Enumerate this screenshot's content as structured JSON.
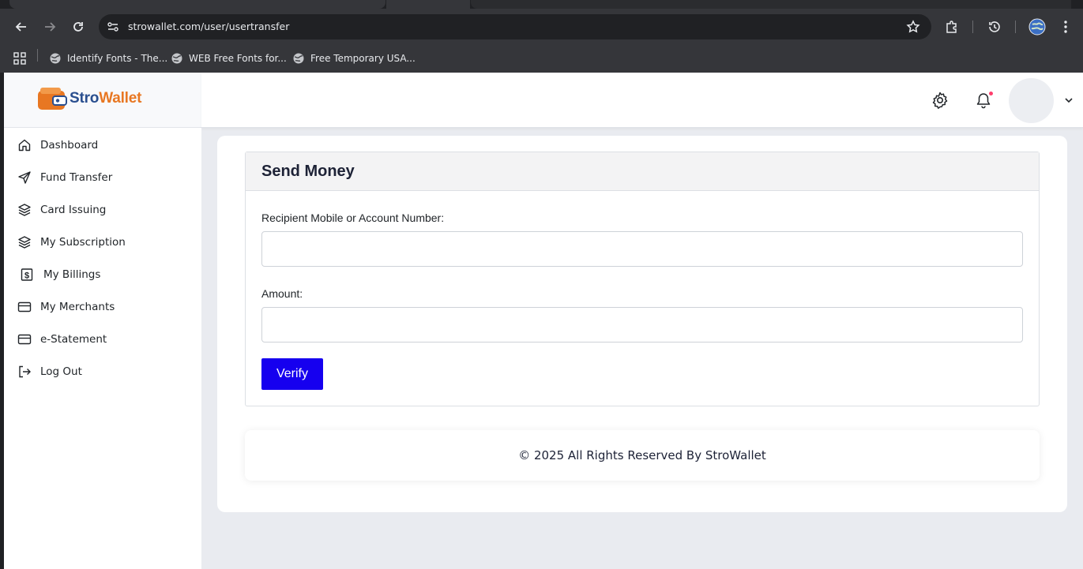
{
  "browser": {
    "url": "strowallet.com/user/usertransfer",
    "bookmarks": [
      {
        "label": "Identify Fonts - The..."
      },
      {
        "label": "WEB Free Fonts for..."
      },
      {
        "label": "Free Temporary USA..."
      }
    ]
  },
  "brand": {
    "name_part1": "Stro",
    "name_part2": "Wallet",
    "color_primary": "#2a4f8f",
    "color_accent": "#e87722"
  },
  "sidebar": {
    "items": [
      {
        "label": "Dashboard",
        "icon": "home-icon"
      },
      {
        "label": "Fund Transfer",
        "icon": "send-icon"
      },
      {
        "label": "Card Issuing",
        "icon": "layers-icon"
      },
      {
        "label": "My Subscription",
        "icon": "layers-icon"
      },
      {
        "label": "My Billings",
        "icon": "dollar-icon"
      },
      {
        "label": "My Merchants",
        "icon": "credit-card-icon"
      },
      {
        "label": "e-Statement",
        "icon": "credit-card-icon"
      },
      {
        "label": "Log Out",
        "icon": "logout-icon"
      }
    ]
  },
  "header": {
    "settings_icon": "gear-icon",
    "notifications_icon": "bell-icon"
  },
  "form": {
    "title": "Send Money",
    "recipient_label": "Recipient Mobile or Account Number:",
    "recipient_value": "",
    "amount_label": "Amount:",
    "amount_value": "",
    "submit_label": "Verify",
    "submit_color": "#1600ef"
  },
  "footer": {
    "text": "© 2025 All Rights Reserved By StroWallet"
  }
}
